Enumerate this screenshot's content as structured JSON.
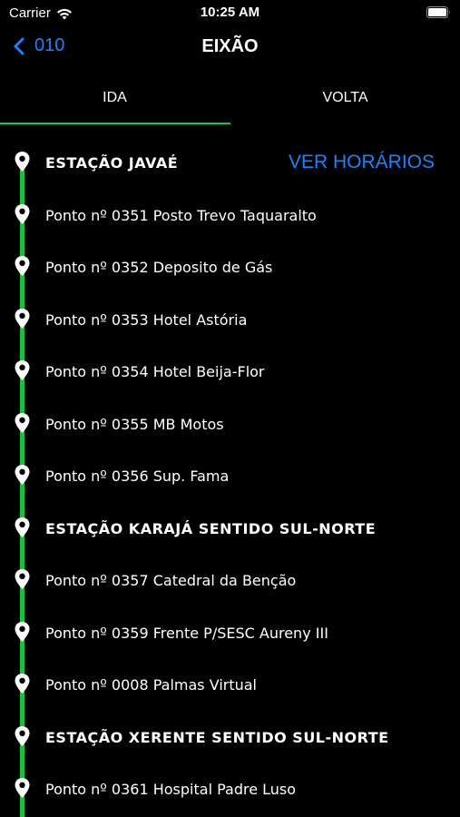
{
  "status_bar": {
    "carrier": "Carrier",
    "time": "10:25 AM"
  },
  "nav": {
    "back_label": "010",
    "title": "EIXÃO"
  },
  "tabs": [
    {
      "label": "IDA",
      "active": true
    },
    {
      "label": "VOLTA",
      "active": false
    }
  ],
  "schedule_button": "VER HORÁRIOS",
  "colors": {
    "accent": "#1a84ff",
    "route": "#1fbd3b",
    "background": "#000000"
  },
  "stops": [
    {
      "label": "ESTAÇÃO JAVAÉ",
      "station": true
    },
    {
      "label": "Ponto nº 0351 Posto Trevo Taquaralto",
      "station": false
    },
    {
      "label": "Ponto nº 0352 Deposito de Gás",
      "station": false
    },
    {
      "label": "Ponto nº 0353 Hotel Astória",
      "station": false
    },
    {
      "label": "Ponto nº 0354 Hotel Beija-Flor",
      "station": false
    },
    {
      "label": "Ponto nº 0355 MB Motos",
      "station": false
    },
    {
      "label": "Ponto nº 0356 Sup. Fama",
      "station": false
    },
    {
      "label": "ESTAÇÃO KARAJÁ SENTIDO SUL-NORTE",
      "station": true
    },
    {
      "label": "Ponto nº 0357 Catedral da Benção",
      "station": false
    },
    {
      "label": "Ponto nº 0359 Frente P/SESC Aureny III",
      "station": false
    },
    {
      "label": "Ponto nº 0008 Palmas Virtual",
      "station": false
    },
    {
      "label": "ESTAÇÃO XERENTE SENTIDO SUL-NORTE",
      "station": true
    },
    {
      "label": "Ponto nº 0361 Hospital Padre Luso",
      "station": false
    }
  ]
}
